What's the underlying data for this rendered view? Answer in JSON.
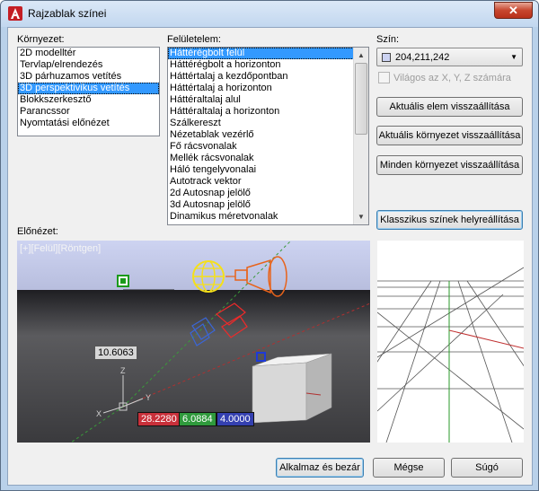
{
  "window": {
    "title": "Rajzablak színei",
    "close_label": "✕"
  },
  "environment": {
    "label": "Környezet:",
    "items": [
      "2D modelltér",
      "Tervlap/elrendezés",
      "3D párhuzamos vetítés",
      "3D perspektivikus vetítés",
      "Blokkszerkesztő",
      "Parancssor",
      "Nyomtatási előnézet"
    ],
    "selected_index": 3
  },
  "interface_element": {
    "label": "Felületelem:",
    "items": [
      "Háttérégbolt felül",
      "Háttérégbolt a horizonton",
      "Háttértalaj a kezdőpontban",
      "Háttértalaj a horizonton",
      "Háttéraltalaj alul",
      "Háttéraltalaj a horizonton",
      "Szálkereszt",
      "Nézetablak vezérlő",
      "Fő rácsvonalak",
      "Mellék rácsvonalak",
      "Háló tengelyvonalai",
      "Autotrack vektor",
      "2d Autosnap jelölő",
      "3d Autosnap jelölő",
      "Dinamikus méretvonalak"
    ],
    "selected_index": 0
  },
  "color": {
    "label": "Szín:",
    "value": "204,211,242",
    "swatch_color": "#ccd3f2",
    "tint_checkbox_label": "Világos az X, Y, Z számára",
    "tint_checked": false
  },
  "buttons": {
    "restore_current_element": "Aktuális elem visszaállítása",
    "restore_current_context": "Aktuális környezet visszaállítása",
    "restore_all_contexts": "Minden környezet visszaállítása",
    "restore_classic_colors": "Klasszikus színek helyreállítása",
    "apply_close": "Alkalmaz és bezár",
    "cancel": "Mégse",
    "help": "Súgó"
  },
  "preview": {
    "label": "Előnézet:",
    "viewport_label": "[+][Felül][Röntgen]",
    "dim_value": "10.6063",
    "coord_x": "28.2280",
    "coord_y": "6.0884",
    "coord_z": "4.0000",
    "axis_z_label": "Z",
    "axis_x_label": "X",
    "axis_y_label": "Y"
  },
  "colors": {
    "selection": "#3399ff",
    "coord_x_bg": "#c8303a",
    "coord_y_bg": "#2f9a3c",
    "coord_z_bg": "#3440b0"
  }
}
